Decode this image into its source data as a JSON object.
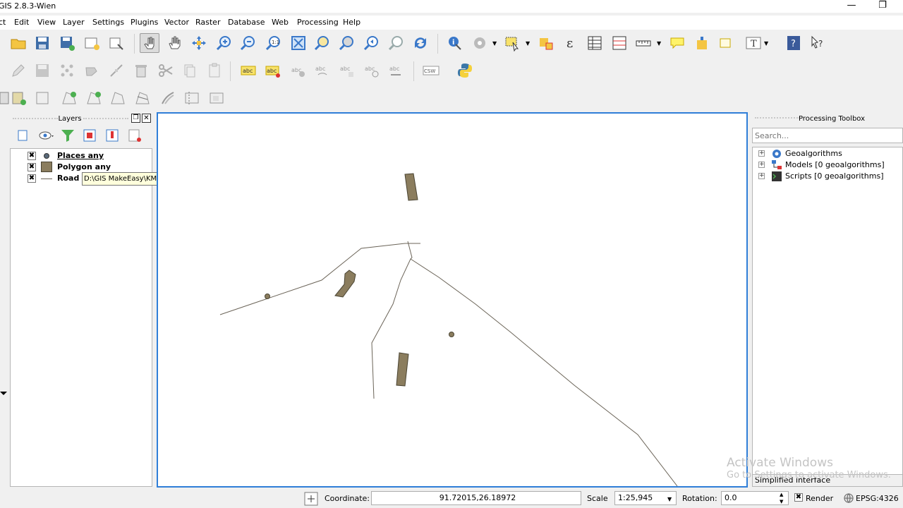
{
  "window": {
    "title": "GIS 2.8.3-Wien",
    "title_visible": "GIS 2.8.3-Wien"
  },
  "menu": [
    "ct",
    "Edit",
    "View",
    "Layer",
    "Settings",
    "Plugins",
    "Vector",
    "Raster",
    "Database",
    "Web",
    "Processing",
    "Help"
  ],
  "layers_panel": {
    "title": "Layers",
    "layers": [
      {
        "name": "Places any",
        "checked": "✖",
        "type": "point"
      },
      {
        "name": "Polygon any",
        "checked": "✖",
        "type": "polygon"
      },
      {
        "name": "Road any",
        "checked": "✖",
        "type": "line"
      }
    ],
    "tooltip": "D:\\GIS MakeEasy\\KML\\New_Project.kml|layername=Places"
  },
  "processing_panel": {
    "title": "Processing Toolbox",
    "search_placeholder": "Search...",
    "items": [
      {
        "label": "Geoalgorithms",
        "icon": "gear-icon"
      },
      {
        "label": "Models [0 geoalgorithms]",
        "icon": "models-icon"
      },
      {
        "label": "Scripts [0 geoalgorithms]",
        "icon": "scripts-icon"
      }
    ],
    "simplified": "Simplified interface"
  },
  "status": {
    "coordinate_label": "Coordinate:",
    "coordinate_value": "91.72015,26.18972",
    "scale_label": "Scale",
    "scale_value": "1:25,945",
    "rotation_label": "Rotation:",
    "rotation_value": "0.0",
    "render_label": "Render",
    "render_checked": "✖",
    "crs": "EPSG:4326"
  },
  "watermark": {
    "line1": "Activate Windows",
    "line2": "Go to Settings to activate Windows."
  },
  "colors": {
    "feature_fill": "#8b7d5e",
    "feature_stroke": "#4a4433",
    "road": "#6b6458",
    "canvas_border": "#2f7ed8"
  }
}
